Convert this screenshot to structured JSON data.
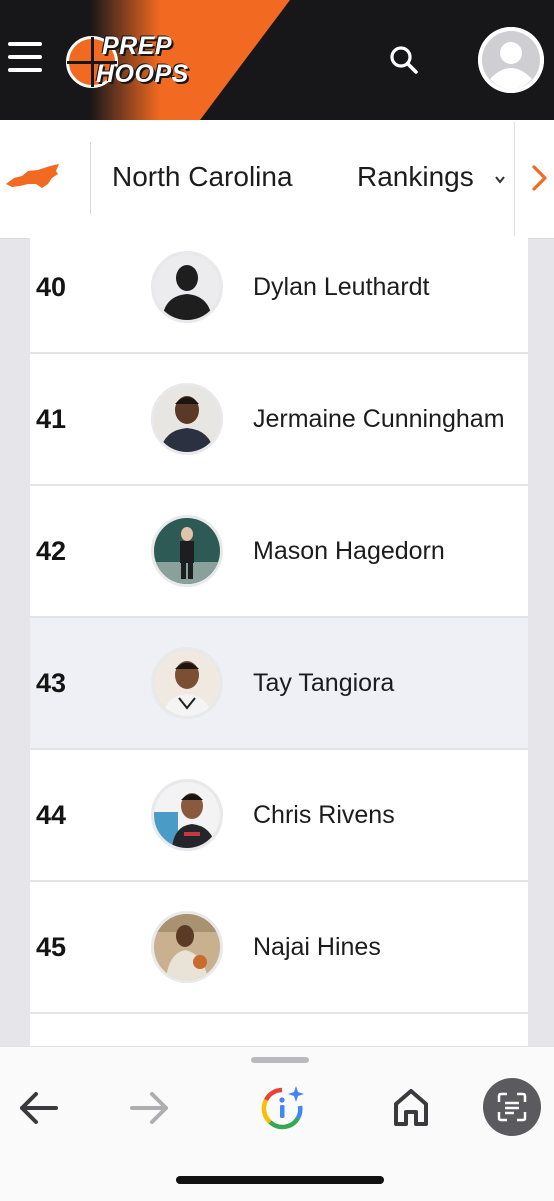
{
  "header": {
    "logo_line1": "PREP",
    "logo_line2": "HOOPS",
    "menu_icon": "hamburger-menu-icon",
    "search_icon": "search-icon",
    "profile_icon": "user-avatar-icon",
    "brand_orange": "#f26a21",
    "header_bg": "#17171a"
  },
  "subnav": {
    "state_icon": "north-carolina-state-shape-icon",
    "state_label": "North Carolina",
    "rankings_label": "Rankings",
    "rankings_dropdown_icon": "chevron-down-icon",
    "next_icon": "chevron-right-icon"
  },
  "rankings": [
    {
      "rank": "40",
      "name": "Dylan Leuthardt",
      "photo": "default-player-silhouette"
    },
    {
      "rank": "41",
      "name": "Jermaine Cunningham",
      "photo": "player-photo"
    },
    {
      "rank": "42",
      "name": "Mason Hagedorn",
      "photo": "player-photo"
    },
    {
      "rank": "43",
      "name": "Tay Tangiora",
      "photo": "player-photo"
    },
    {
      "rank": "44",
      "name": "Chris Rivens",
      "photo": "player-photo"
    },
    {
      "rank": "45",
      "name": "Najai Hines",
      "photo": "player-photo"
    }
  ],
  "browser": {
    "back_icon": "back-arrow-icon",
    "forward_icon": "forward-arrow-icon",
    "assistant_icon": "google-lens-sparkle-icon",
    "home_icon": "home-icon",
    "scan_icon": "scan-text-icon"
  }
}
